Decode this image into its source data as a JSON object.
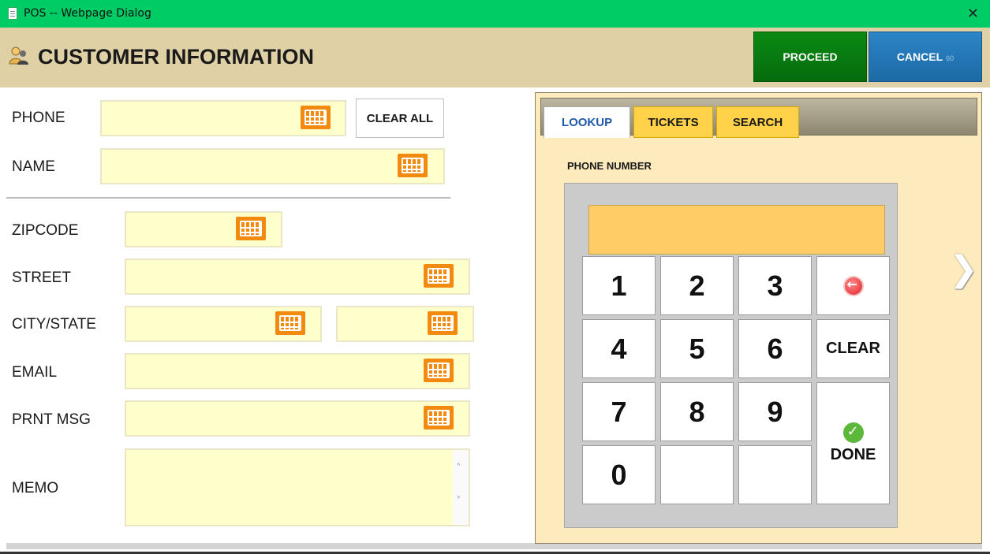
{
  "window": {
    "title": "POS -- Webpage Dialog",
    "close": "✕"
  },
  "header": {
    "title": "CUSTOMER INFORMATION",
    "proceed_label": "PROCEED",
    "cancel_label": "CANCEL",
    "cancel_countdown": "60"
  },
  "form": {
    "phone_label": "PHONE",
    "name_label": "NAME",
    "zip_label": "ZIPCODE",
    "street_label": "STREET",
    "city_label": "CITY/STATE",
    "email_label": "EMAIL",
    "prnt_label": "PRNT MSG",
    "memo_label": "MEMO",
    "clear_all_label": "CLEAR ALL",
    "memo_scroll_up": "˄",
    "memo_scroll_down": "˅"
  },
  "lookup": {
    "tabs": [
      "LOOKUP",
      "TICKETS",
      "SEARCH"
    ],
    "active_tab": "LOOKUP",
    "phone_number_label": "PHONE NUMBER",
    "display_value": "",
    "keys": [
      "1",
      "2",
      "3",
      "4",
      "5",
      "6",
      "7",
      "8",
      "9",
      "0"
    ],
    "clear_label": "CLEAR",
    "done_label": "DONE",
    "next_arrow": "❯"
  },
  "colors": {
    "titlebar": "#00cc66",
    "header": "#dfd0a5",
    "field": "#ffffcc",
    "keyboard": "#f28a0f",
    "proceed": "#0a8a13",
    "cancel": "#2b85c7",
    "display": "#ffcc66"
  }
}
